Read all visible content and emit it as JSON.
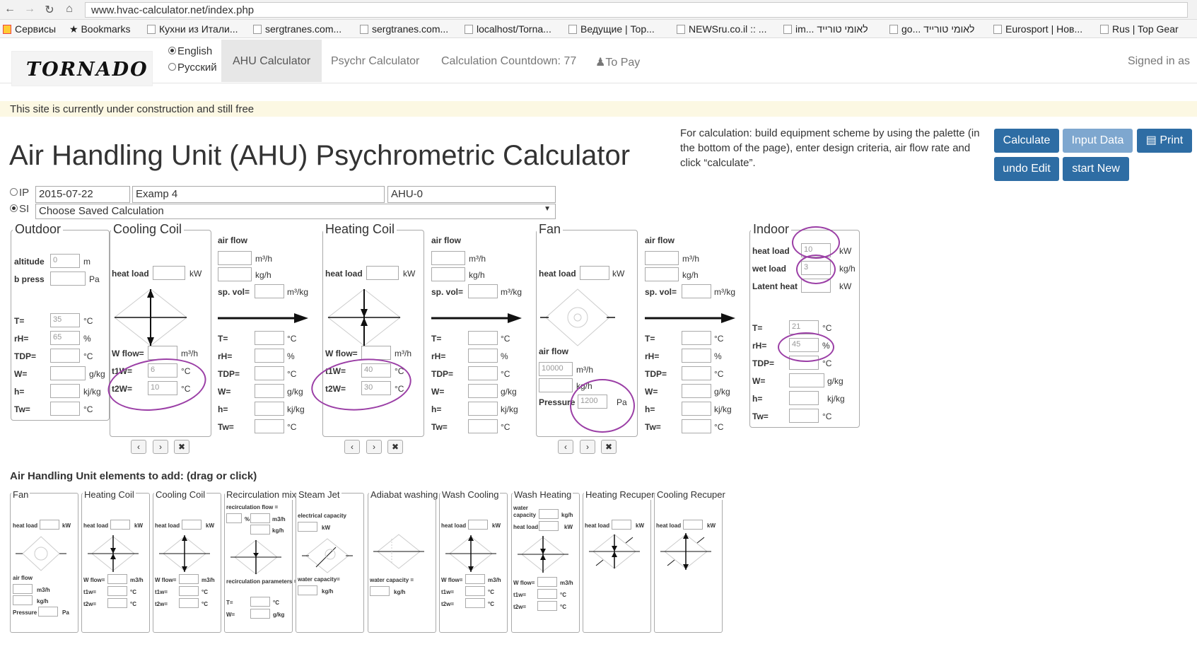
{
  "browser": {
    "url": "www.hvac-calculator.net/index.php",
    "bookmarks": [
      "Сервисы",
      "Bookmarks",
      "Кухни из Итали...",
      "sergtranes.com...",
      "sergtranes.com...",
      "localhost/Torna...",
      "Ведущие | Top...",
      "NEWSru.co.il :: ...",
      "im... לאומי טורייד",
      "go... לאומי טורייד",
      "Eurosport | Нов...",
      "Rus | Top Gear"
    ]
  },
  "nav": {
    "logo": "TORNADO",
    "lang_en": "English",
    "lang_ru": "Русский",
    "tab_ahu": "AHU Calculator",
    "tab_psychr": "Psychr Calculator",
    "countdown": "Calculation Countdown: 77",
    "to_pay": "To Pay",
    "signed": "Signed in as"
  },
  "notice": "This site is currently under construction and still free",
  "title": "Air Handling Unit (AHU) Psychrometric Calculator",
  "help": "For calculation: build equipment scheme by using the palette (in the bottom of the page), enter design criteria, air flow rate and click “calculate”.",
  "buttons": {
    "calculate": "Calculate",
    "input_data": "Input Data",
    "print": "Print",
    "undo": "undo Edit",
    "start_new": "start New"
  },
  "form": {
    "ip": "IP",
    "si": "SI",
    "date": "2015-07-22",
    "name": "Examp 4",
    "unit": "AHU-0",
    "saved": "Choose Saved Calculation"
  },
  "outdoor": {
    "title": "Outdoor",
    "altitude": "altitude",
    "altitude_val": "0",
    "altitude_unit": "m",
    "bpress": "b press",
    "bpress_unit": "Pa",
    "T": "T=",
    "T_val": "35",
    "rH": "rH=",
    "rH_val": "65",
    "TDP": "TDP=",
    "W": "W=",
    "h": "h=",
    "Tw": "Tw=",
    "u_c": "°C",
    "u_pct": "%",
    "u_gkg": "g/kg",
    "u_kjkg": "kj/kg"
  },
  "cooling": {
    "title": "Cooling Coil",
    "heat_load": "heat load",
    "kW": "kW",
    "wflow": "W flow=",
    "wflow_unit": "m³/h",
    "t1w": "t1W=",
    "t1w_val": "6",
    "t2w": "t2W=",
    "t2w_val": "10",
    "u_c": "°C"
  },
  "heating": {
    "title": "Heating Coil",
    "heat_load": "heat load",
    "kW": "kW",
    "wflow": "W flow=",
    "wflow_unit": "m³/h",
    "t1w": "t1W=",
    "t1w_val": "40",
    "t2w": "t2W=",
    "t2w_val": "30",
    "u_c": "°C"
  },
  "fan": {
    "title": "Fan",
    "heat_load": "heat load",
    "kW": "kW",
    "air_flow": "air flow",
    "flow_val": "10000",
    "m3h": "m³/h",
    "kgh": "kg/h",
    "pressure": "Pressure",
    "pressure_val": "1200",
    "pa": "Pa"
  },
  "airflow": {
    "title": "air flow",
    "m3h": "m³/h",
    "kgh": "kg/h",
    "spvol": "sp. vol=",
    "spvol_unit": "m³/kg",
    "T": "T=",
    "rH": "rH=",
    "TDP": "TDP=",
    "W": "W=",
    "h": "h=",
    "Tw": "Tw=",
    "u_c": "°C",
    "u_pct": "%",
    "u_gkg": "g/kg",
    "u_kjkg": "kj/kg"
  },
  "indoor": {
    "title": "Indoor",
    "heat_load": "heat load",
    "heat_val": "10",
    "kW": "kW",
    "wet_load": "wet load",
    "wet_val": "3",
    "kgh": "kg/h",
    "latent": "Latent heat",
    "kW2": "kW",
    "T": "T=",
    "T_val": "21",
    "rH": "rH=",
    "rH_val": "45",
    "TDP": "TDP=",
    "W": "W=",
    "h": "h=",
    "Tw": "Tw=",
    "u_c": "°C",
    "u_pct": "%",
    "u_gkg": "g/kg",
    "u_kjkg": "kj/kg"
  },
  "controls": {
    "prev": "‹",
    "next": "›",
    "del": "✖"
  },
  "palette": {
    "heading": "Air Handling Unit elements to add: (drag or click)",
    "items": [
      "Fan",
      "Heating Coil",
      "Cooling Coil",
      "Recirculation mix",
      "Steam Jet",
      "Adiabat washing",
      "Wash Cooling",
      "Wash Heating",
      "Heating Recuper",
      "Cooling Recuper"
    ],
    "heat_load": "heat load",
    "kW": "kW",
    "air_flow": "air flow",
    "m3h": "m3/h",
    "kgh": "kg/h",
    "pressure": "Pressure",
    "pa": "Pa",
    "wflow": "W flow=",
    "t1w": "t1w=",
    "t2w": "t2w=",
    "degc": "°C",
    "recirc_flow": "recirculation flow =",
    "pct": "%",
    "recirc_params": "recirculation parameters =",
    "T": "T=",
    "W": "W=",
    "gkg": "g/kg",
    "elec_cap": "electrical capacity",
    "water_cap": "water capacity=",
    "water_cap2": "water capacity =",
    "water": "water",
    "capacity": "capacity"
  }
}
